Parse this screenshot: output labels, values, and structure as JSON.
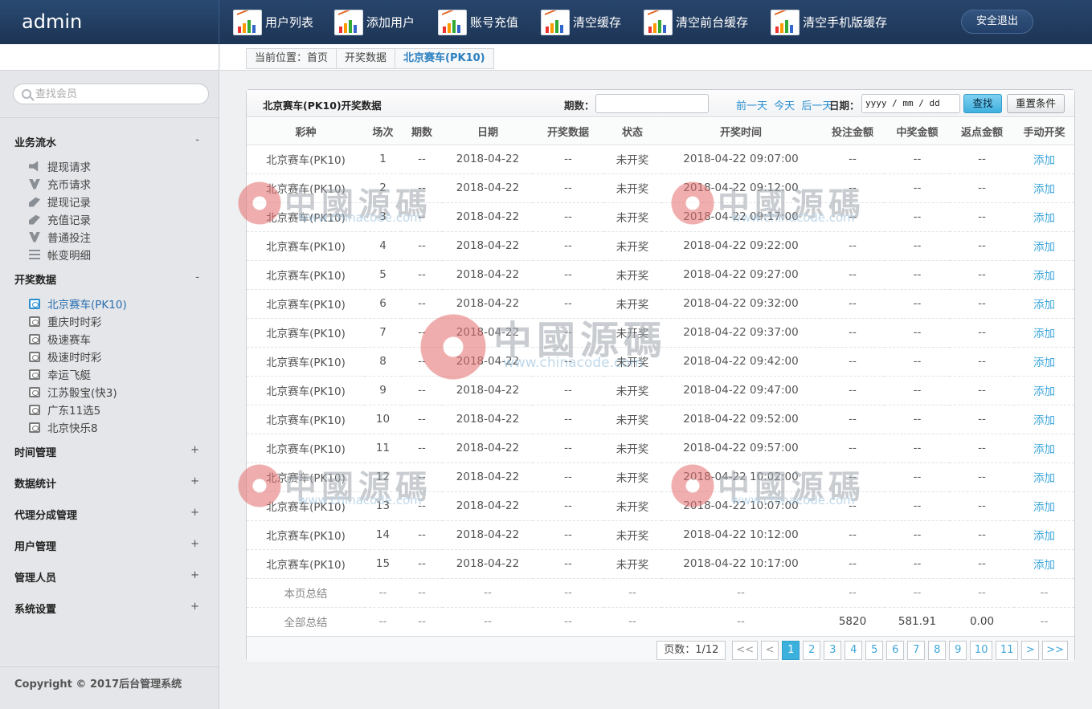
{
  "header": {
    "brand": "admin",
    "nav": [
      "用户列表",
      "添加用户",
      "账号充值",
      "清空缓存",
      "清空前台缓存",
      "清空手机版缓存"
    ],
    "logout": "安全退出"
  },
  "sidebar": {
    "search_placeholder": "查找会员",
    "groups": [
      {
        "title": "业务流水",
        "toggle": "-"
      },
      {
        "title": "开奖数据",
        "toggle": "-"
      },
      {
        "title": "时间管理",
        "toggle": "+"
      },
      {
        "title": "数据统计",
        "toggle": "+"
      },
      {
        "title": "代理分成管理",
        "toggle": "+"
      },
      {
        "title": "用户管理",
        "toggle": "+"
      },
      {
        "title": "管理人员",
        "toggle": "+"
      },
      {
        "title": "系统设置",
        "toggle": "+"
      }
    ],
    "business_items": [
      "提现请求",
      "充币请求",
      "提现记录",
      "充值记录",
      "普通投注",
      "帐变明细"
    ],
    "lottery_items": [
      "北京赛车(PK10)",
      "重庆时时彩",
      "极速赛车",
      "极速时时彩",
      "幸运飞艇",
      "江苏骰宝(快3)",
      "广东11选5",
      "北京快乐8"
    ],
    "footer": "Copyright © 2017后台管理系统"
  },
  "breadcrumb": {
    "label": "当前位置：首页",
    "parent": "开奖数据",
    "current": "北京赛车(PK10)"
  },
  "panel": {
    "title": "北京赛车(PK10)开奖数据",
    "qishu_label": "期数：",
    "prev_day": "前一天",
    "today": "今天",
    "next_day": "后一天",
    "date_label": "日期：",
    "date_placeholder": "yyyy / mm / dd",
    "find_btn": "查找",
    "reset_btn": "重置条件"
  },
  "table": {
    "columns": [
      "彩种",
      "场次",
      "期数",
      "日期",
      "开奖数据",
      "状态",
      "开奖时间",
      "投注金额",
      "中奖金额",
      "返点金额",
      "手动开奖"
    ],
    "rows": [
      [
        "北京赛车(PK10)",
        "1",
        "--",
        "2018-04-22",
        "--",
        "未开奖",
        "2018-04-22 09:07:00",
        "--",
        "--",
        "--",
        "添加"
      ],
      [
        "北京赛车(PK10)",
        "2",
        "--",
        "2018-04-22",
        "--",
        "未开奖",
        "2018-04-22 09:12:00",
        "--",
        "--",
        "--",
        "添加"
      ],
      [
        "北京赛车(PK10)",
        "3",
        "--",
        "2018-04-22",
        "--",
        "未开奖",
        "2018-04-22 09:17:00",
        "--",
        "--",
        "--",
        "添加"
      ],
      [
        "北京赛车(PK10)",
        "4",
        "--",
        "2018-04-22",
        "--",
        "未开奖",
        "2018-04-22 09:22:00",
        "--",
        "--",
        "--",
        "添加"
      ],
      [
        "北京赛车(PK10)",
        "5",
        "--",
        "2018-04-22",
        "--",
        "未开奖",
        "2018-04-22 09:27:00",
        "--",
        "--",
        "--",
        "添加"
      ],
      [
        "北京赛车(PK10)",
        "6",
        "--",
        "2018-04-22",
        "--",
        "未开奖",
        "2018-04-22 09:32:00",
        "--",
        "--",
        "--",
        "添加"
      ],
      [
        "北京赛车(PK10)",
        "7",
        "--",
        "2018-04-22",
        "--",
        "未开奖",
        "2018-04-22 09:37:00",
        "--",
        "--",
        "--",
        "添加"
      ],
      [
        "北京赛车(PK10)",
        "8",
        "--",
        "2018-04-22",
        "--",
        "未开奖",
        "2018-04-22 09:42:00",
        "--",
        "--",
        "--",
        "添加"
      ],
      [
        "北京赛车(PK10)",
        "9",
        "--",
        "2018-04-22",
        "--",
        "未开奖",
        "2018-04-22 09:47:00",
        "--",
        "--",
        "--",
        "添加"
      ],
      [
        "北京赛车(PK10)",
        "10",
        "--",
        "2018-04-22",
        "--",
        "未开奖",
        "2018-04-22 09:52:00",
        "--",
        "--",
        "--",
        "添加"
      ],
      [
        "北京赛车(PK10)",
        "11",
        "--",
        "2018-04-22",
        "--",
        "未开奖",
        "2018-04-22 09:57:00",
        "--",
        "--",
        "--",
        "添加"
      ],
      [
        "北京赛车(PK10)",
        "12",
        "--",
        "2018-04-22",
        "--",
        "未开奖",
        "2018-04-22 10:02:00",
        "--",
        "--",
        "--",
        "添加"
      ],
      [
        "北京赛车(PK10)",
        "13",
        "--",
        "2018-04-22",
        "--",
        "未开奖",
        "2018-04-22 10:07:00",
        "--",
        "--",
        "--",
        "添加"
      ],
      [
        "北京赛车(PK10)",
        "14",
        "--",
        "2018-04-22",
        "--",
        "未开奖",
        "2018-04-22 10:12:00",
        "--",
        "--",
        "--",
        "添加"
      ],
      [
        "北京赛车(PK10)",
        "15",
        "--",
        "2018-04-22",
        "--",
        "未开奖",
        "2018-04-22 10:17:00",
        "--",
        "--",
        "--",
        "添加"
      ]
    ],
    "summary": [
      [
        "本页总结",
        "--",
        "--",
        "--",
        "--",
        "--",
        "--",
        "--",
        "--",
        "--",
        "--"
      ],
      [
        "全部总结",
        "--",
        "--",
        "--",
        "--",
        "--",
        "--",
        "5820",
        "581.91",
        "0.00",
        "--"
      ]
    ]
  },
  "pager": {
    "info": "页数：1/12",
    "first": "<<",
    "prev": "<",
    "pages": [
      "1",
      "2",
      "3",
      "4",
      "5",
      "6",
      "7",
      "8",
      "9",
      "10",
      "11"
    ],
    "current": "1",
    "next": ">",
    "last": ">>"
  },
  "watermark": {
    "cn": "中國源碼",
    "en": "www.chinacode.com"
  }
}
